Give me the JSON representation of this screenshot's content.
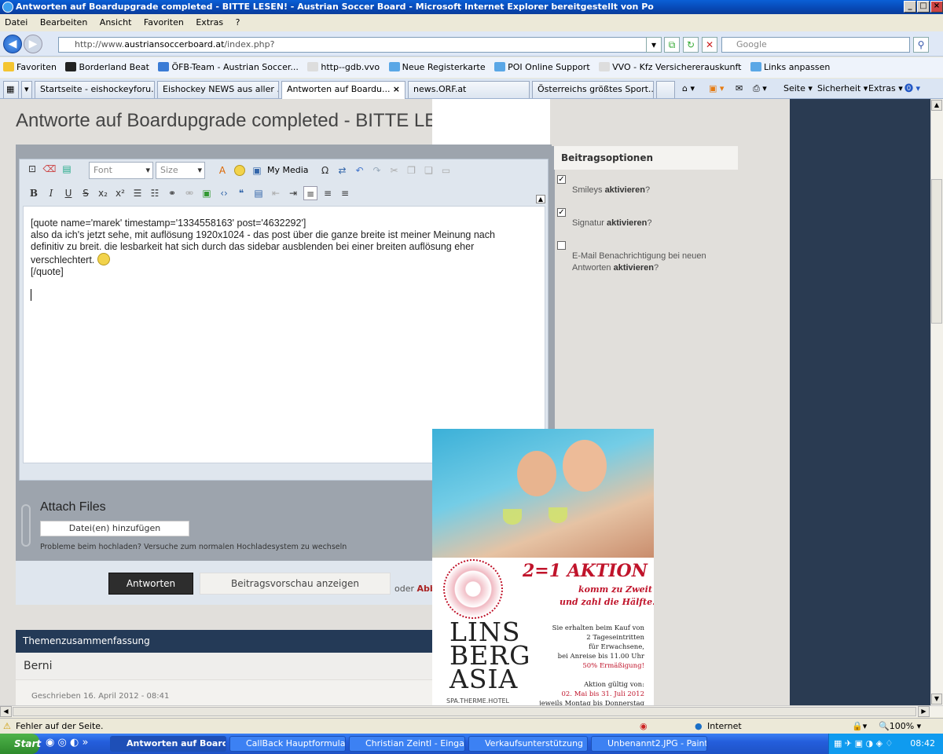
{
  "window": {
    "title": "Antworten auf Boardupgrade completed - BITTE LESEN! - Austrian Soccer Board - Microsoft Internet Explorer bereitgestellt von Po",
    "btn_min": "_",
    "btn_max": "□",
    "btn_close": "×"
  },
  "menu": [
    "Datei",
    "Bearbeiten",
    "Ansicht",
    "Favoriten",
    "Extras",
    "?"
  ],
  "address": {
    "prefix": "http://www.",
    "domain": "austriansoccerboard.at",
    "suffix": "/index.php?",
    "search_placeholder": "Google"
  },
  "favorites": {
    "label": "Favoriten",
    "items": [
      "Borderland Beat",
      "ÖFB-Team - Austrian Soccer...",
      "http--gdb.vvo",
      "Neue Registerkarte",
      "POI Online Support",
      "VVO - Kfz Versichererauskunft",
      "Links anpassen"
    ]
  },
  "tabs": [
    "Startseite - eishockeyforu...",
    "Eishockey NEWS aus aller ...",
    "Antworten auf Boardu...",
    "news.ORF.at",
    "Österreichs größtes Sport..."
  ],
  "commands": {
    "seite": "Seite ▾",
    "sicherheit": "Sicherheit ▾",
    "extras": "Extras ▾"
  },
  "page": {
    "title": "Antworte auf Boardupgrade completed - BITTE LE"
  },
  "editor": {
    "font_placeholder": "Font",
    "size_placeholder": "Size",
    "my_media": "My Media",
    "lines": [
      "[quote name='marek' timestamp='1334558163' post='4632292']",
      "also da ich's jetzt sehe, mit auflösung 1920x1024 - das post über die ganze breite ist meiner Meinung nach",
      "definitiv zu breit. die lesbarkeit hat sich durch das sidebar ausblenden bei einer breiten auflösung eher",
      "verschlechtert.",
      "[/quote]"
    ]
  },
  "options": {
    "header": "Beitragsoptionen",
    "smileys": {
      "pre": "Smileys ",
      "bold": "aktivieren",
      "post": "?",
      "checked": true
    },
    "signatur": {
      "pre": "Signatur ",
      "bold": "aktivieren",
      "post": "?",
      "checked": true
    },
    "email": {
      "line1": "E-Mail Benachrichtigung bei neuen",
      "pre": "Antworten ",
      "bold": "aktivieren",
      "post": "?",
      "checked": false
    }
  },
  "attach": {
    "title": "Attach Files",
    "button": "Datei(en) hinzufügen",
    "hint": "Probleme beim hochladen? Versuche zum normalen Hochladesystem zu wechseln"
  },
  "actions": {
    "submit": "Antworten",
    "preview": "Beitragsvorschau anzeigen",
    "or": "oder",
    "cancel": "Abb"
  },
  "summary": {
    "header": "Themenzusammenfassung",
    "author": "Berni",
    "date": "Geschrieben 16. April 2012 - 08:41"
  },
  "ad": {
    "headline": "2=1 AKTION",
    "sub1": "komm zu Zweit",
    "sub2": "und zahl die Hälfte!",
    "brand1": "LINS",
    "brand2": "BERG",
    "brand3": "ASIA",
    "brand_sub": "SPA.THERME.HOTEL",
    "text": [
      "Sie erhalten beim Kauf von",
      "2 Tageseintritten",
      "für Erwachsene,",
      "bei Anreise bis 11.00 Uhr"
    ],
    "discount": "50% Ermäßigung!",
    "valid": "Aktion gültig von:",
    "dates": "02. Mai bis 31. Juli 2012",
    "more": "jeweils Montag bis Donnerstag",
    "accent": "#c0142b"
  },
  "status": {
    "error": "Fehler auf der Seite.",
    "zone": "Internet",
    "zoom": "100%"
  },
  "taskbar": {
    "start": "Start",
    "items": [
      "Antworten auf Board...",
      "CallBack Hauptformular",
      "Christian Zeintl - Eingang...",
      "Verkaufsunterstützung",
      "Unbenannt2.JPG - Paint"
    ],
    "time": "08:42"
  }
}
